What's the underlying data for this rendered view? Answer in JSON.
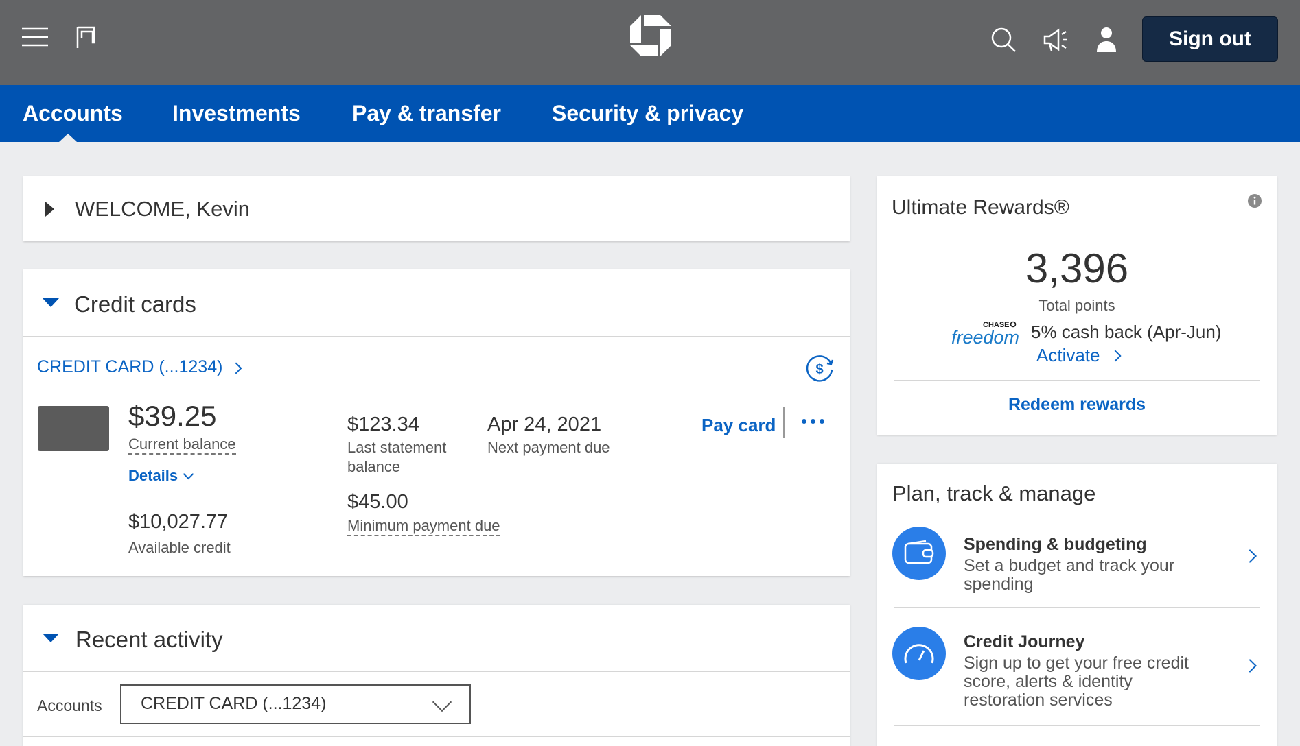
{
  "header": {
    "signout_label": "Sign out",
    "icons": [
      "menu-icon",
      "flag-icon",
      "chase-logo",
      "search-icon",
      "megaphone-icon",
      "user-icon"
    ]
  },
  "nav": {
    "tabs": [
      {
        "label": "Accounts",
        "active": true
      },
      {
        "label": "Investments"
      },
      {
        "label": "Pay & transfer"
      },
      {
        "label": "Security & privacy"
      }
    ]
  },
  "welcome": {
    "text": "WELCOME, Kevin"
  },
  "credit_cards": {
    "title": "Credit cards",
    "card_link": "CREDIT CARD (...1234)",
    "current_balance": "$39.25",
    "current_balance_label": "Current balance",
    "details_label": "Details",
    "available_credit": "$10,027.77",
    "available_credit_label": "Available credit",
    "last_statement_balance": "$123.34",
    "last_statement_label_1": "Last statement",
    "last_statement_label_2": "balance",
    "minimum_payment": "$45.00",
    "minimum_payment_label": "Minimum payment due",
    "next_payment_date": "Apr 24, 2021",
    "next_payment_label": "Next payment due",
    "pay_card_label": "Pay card"
  },
  "recent_activity": {
    "title": "Recent activity",
    "accounts_label": "Accounts",
    "selected_account": "CREDIT CARD (...1234)"
  },
  "rewards": {
    "title": "Ultimate Rewards®",
    "points": "3,396",
    "points_label": "Total points",
    "freedom_brand_top": "CHASE",
    "freedom_brand": "freedom",
    "cashback_text": "5% cash back (Apr-Jun)",
    "activate_label": "Activate",
    "redeem_label": "Redeem rewards"
  },
  "plan": {
    "title": "Plan, track & manage",
    "items": [
      {
        "heading": "Spending & budgeting",
        "desc_1": "Set a budget and track your",
        "desc_2": "spending"
      },
      {
        "heading": "Credit Journey",
        "desc_1": "Sign up to get your free credit",
        "desc_2": "score, alerts & identity",
        "desc_3": "restoration services"
      }
    ]
  },
  "colors": {
    "topbar": "#636466",
    "nav": "#0053b2",
    "link": "#0b64c4",
    "signout_bg": "#152a45",
    "background": "#ecedef"
  }
}
